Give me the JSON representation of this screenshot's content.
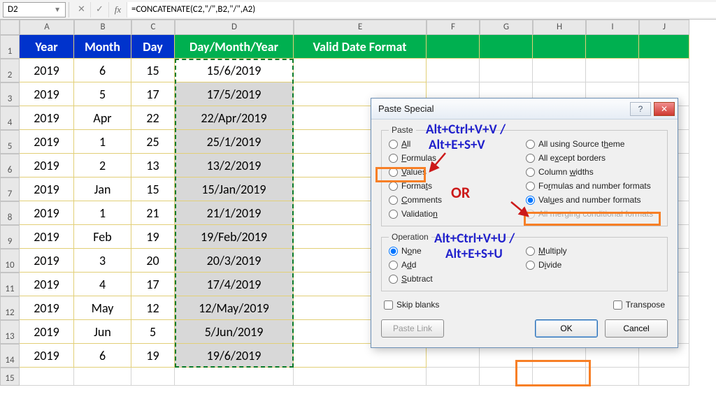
{
  "formula_bar": {
    "name_box": "D2",
    "formula": "=CONCATENATE(C2,\"/\",B2,\"/\",A2)"
  },
  "columns": [
    "A",
    "B",
    "C",
    "D",
    "E",
    "F",
    "G",
    "H",
    "I",
    "J"
  ],
  "header": {
    "A": "Year",
    "B": "Month",
    "C": "Day",
    "D": "Day/Month/Year",
    "E": "Valid Date Format"
  },
  "rows": [
    {
      "n": 2,
      "A": "2019",
      "B": "6",
      "C": "15",
      "D": "15/6/2019"
    },
    {
      "n": 3,
      "A": "2019",
      "B": "5",
      "C": "17",
      "D": "17/5/2019"
    },
    {
      "n": 4,
      "A": "2019",
      "B": "Apr",
      "C": "22",
      "D": "22/Apr/2019"
    },
    {
      "n": 5,
      "A": "2019",
      "B": "1",
      "C": "25",
      "D": "25/1/2019"
    },
    {
      "n": 6,
      "A": "2019",
      "B": "2",
      "C": "13",
      "D": "13/2/2019"
    },
    {
      "n": 7,
      "A": "2019",
      "B": "Jan",
      "C": "15",
      "D": "15/Jan/2019"
    },
    {
      "n": 8,
      "A": "2019",
      "B": "1",
      "C": "21",
      "D": "21/1/2019"
    },
    {
      "n": 9,
      "A": "2019",
      "B": "Feb",
      "C": "19",
      "D": "19/Feb/2019"
    },
    {
      "n": 10,
      "A": "2019",
      "B": "3",
      "C": "20",
      "D": "20/3/2019"
    },
    {
      "n": 11,
      "A": "2019",
      "B": "4",
      "C": "17",
      "D": "17/4/2019"
    },
    {
      "n": 12,
      "A": "2019",
      "B": "May",
      "C": "12",
      "D": "12/May/2019"
    },
    {
      "n": 13,
      "A": "2019",
      "B": "Jun",
      "C": "5",
      "D": "5/Jun/2019"
    },
    {
      "n": 14,
      "A": "2019",
      "B": "6",
      "C": "19",
      "D": "19/6/2019"
    }
  ],
  "extra_row": 15,
  "dialog": {
    "title": "Paste Special",
    "paste_legend": "Paste",
    "operation_legend": "Operation",
    "p_all": "All",
    "p_formulas": "Formulas",
    "p_values": "Values",
    "p_formats": "Formats",
    "p_comments": "Comments",
    "p_validation": "Validation",
    "p_all_source": "All using Source theme",
    "p_except_borders": "All except borders",
    "p_col_widths": "Column widths",
    "p_formulas_num": "Formulas and number formats",
    "p_values_num": "Values and number formats",
    "p_merge_cond": "All merging conditional formats",
    "op_none": "None",
    "op_add": "Add",
    "op_subtract": "Subtract",
    "op_multiply": "Multiply",
    "op_divide": "Divide",
    "cb_skip": "Skip blanks",
    "cb_transpose": "Transpose",
    "btn_paste_link": "Paste Link",
    "btn_ok": "OK",
    "btn_cancel": "Cancel"
  },
  "annotations": {
    "top1": "Alt+Ctrl+V+V /",
    "top2": "Alt+E+S+V",
    "or": "OR",
    "bot1": "Alt+Ctrl+V+U /",
    "bot2": "Alt+E+S+U"
  }
}
